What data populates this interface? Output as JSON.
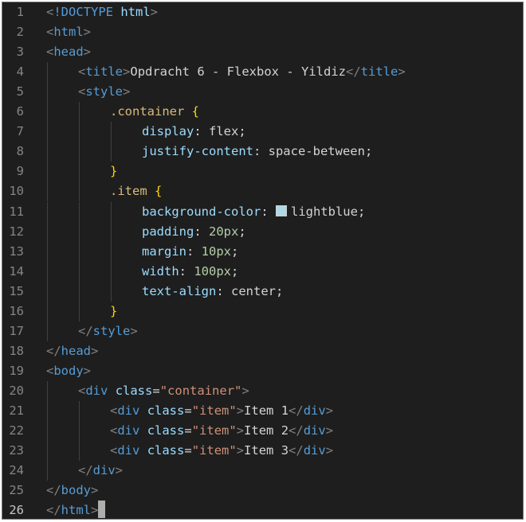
{
  "editor": {
    "active_line": 26,
    "colors": {
      "background": "#1e1e1e",
      "line_number": "#858585",
      "punctuation": "#808080",
      "tag": "#569cd6",
      "attribute": "#9cdcfe",
      "string": "#ce9178",
      "selector": "#d7ba7d",
      "number": "#b5cea8",
      "bracket": "#ffd700",
      "text": "#d4d4d4"
    },
    "lines": [
      {
        "n": "1",
        "indent": 0,
        "tokens": [
          [
            "punc",
            "<"
          ],
          [
            "tag",
            "!DOCTYPE "
          ],
          [
            "attr",
            "html"
          ],
          [
            "punc",
            ">"
          ]
        ]
      },
      {
        "n": "2",
        "indent": 0,
        "tokens": [
          [
            "punc",
            "<"
          ],
          [
            "tag",
            "html"
          ],
          [
            "punc",
            ">"
          ]
        ]
      },
      {
        "n": "3",
        "indent": 0,
        "tokens": [
          [
            "punc",
            "<"
          ],
          [
            "tag",
            "head"
          ],
          [
            "punc",
            ">"
          ]
        ]
      },
      {
        "n": "4",
        "indent": 1,
        "tokens": [
          [
            "punc",
            "<"
          ],
          [
            "tag",
            "title"
          ],
          [
            "punc",
            ">"
          ],
          [
            "txt",
            "Opdracht 6 - Flexbox - Yildiz"
          ],
          [
            "punc",
            "</"
          ],
          [
            "tag",
            "title"
          ],
          [
            "punc",
            ">"
          ]
        ]
      },
      {
        "n": "5",
        "indent": 1,
        "tokens": [
          [
            "punc",
            "<"
          ],
          [
            "tag",
            "style"
          ],
          [
            "punc",
            ">"
          ]
        ]
      },
      {
        "n": "6",
        "indent": 2,
        "tokens": [
          [
            "sel",
            ".container"
          ],
          [
            "txt",
            " "
          ],
          [
            "br",
            "{"
          ]
        ]
      },
      {
        "n": "7",
        "indent": 3,
        "tokens": [
          [
            "prop",
            "display"
          ],
          [
            "txt",
            ": flex;"
          ]
        ]
      },
      {
        "n": "8",
        "indent": 3,
        "tokens": [
          [
            "prop",
            "justify-content"
          ],
          [
            "txt",
            ": space-between;"
          ]
        ]
      },
      {
        "n": "9",
        "indent": 2,
        "tokens": [
          [
            "br",
            "}"
          ]
        ]
      },
      {
        "n": "10",
        "indent": 2,
        "tokens": [
          [
            "sel",
            ".item"
          ],
          [
            "txt",
            " "
          ],
          [
            "br",
            "{"
          ]
        ]
      },
      {
        "n": "11",
        "indent": 3,
        "tokens": [
          [
            "prop",
            "background-color"
          ],
          [
            "txt",
            ": "
          ],
          [
            "swatch",
            "#add8e6"
          ],
          [
            "txt",
            "lightblue;"
          ]
        ]
      },
      {
        "n": "12",
        "indent": 3,
        "tokens": [
          [
            "prop",
            "padding"
          ],
          [
            "txt",
            ": "
          ],
          [
            "num",
            "20px"
          ],
          [
            "txt",
            ";"
          ]
        ]
      },
      {
        "n": "13",
        "indent": 3,
        "tokens": [
          [
            "prop",
            "margin"
          ],
          [
            "txt",
            ": "
          ],
          [
            "num",
            "10px"
          ],
          [
            "txt",
            ";"
          ]
        ]
      },
      {
        "n": "14",
        "indent": 3,
        "tokens": [
          [
            "prop",
            "width"
          ],
          [
            "txt",
            ": "
          ],
          [
            "num",
            "100px"
          ],
          [
            "txt",
            ";"
          ]
        ]
      },
      {
        "n": "15",
        "indent": 3,
        "tokens": [
          [
            "prop",
            "text-align"
          ],
          [
            "txt",
            ": center;"
          ]
        ]
      },
      {
        "n": "16",
        "indent": 2,
        "tokens": [
          [
            "br",
            "}"
          ]
        ]
      },
      {
        "n": "17",
        "indent": 1,
        "tokens": [
          [
            "punc",
            "</"
          ],
          [
            "tag",
            "style"
          ],
          [
            "punc",
            ">"
          ]
        ]
      },
      {
        "n": "18",
        "indent": 0,
        "tokens": [
          [
            "punc",
            "</"
          ],
          [
            "tag",
            "head"
          ],
          [
            "punc",
            ">"
          ]
        ]
      },
      {
        "n": "19",
        "indent": 0,
        "tokens": [
          [
            "punc",
            "<"
          ],
          [
            "tag",
            "body"
          ],
          [
            "punc",
            ">"
          ]
        ]
      },
      {
        "n": "20",
        "indent": 1,
        "tokens": [
          [
            "punc",
            "<"
          ],
          [
            "tag",
            "div"
          ],
          [
            "txt",
            " "
          ],
          [
            "attr",
            "class"
          ],
          [
            "txt",
            "="
          ],
          [
            "str",
            "\"container\""
          ],
          [
            "punc",
            ">"
          ]
        ]
      },
      {
        "n": "21",
        "indent": 2,
        "tokens": [
          [
            "punc",
            "<"
          ],
          [
            "tag",
            "div"
          ],
          [
            "txt",
            " "
          ],
          [
            "attr",
            "class"
          ],
          [
            "txt",
            "="
          ],
          [
            "str",
            "\"item\""
          ],
          [
            "punc",
            ">"
          ],
          [
            "txt",
            "Item 1"
          ],
          [
            "punc",
            "</"
          ],
          [
            "tag",
            "div"
          ],
          [
            "punc",
            ">"
          ]
        ]
      },
      {
        "n": "22",
        "indent": 2,
        "tokens": [
          [
            "punc",
            "<"
          ],
          [
            "tag",
            "div"
          ],
          [
            "txt",
            " "
          ],
          [
            "attr",
            "class"
          ],
          [
            "txt",
            "="
          ],
          [
            "str",
            "\"item\""
          ],
          [
            "punc",
            ">"
          ],
          [
            "txt",
            "Item 2"
          ],
          [
            "punc",
            "</"
          ],
          [
            "tag",
            "div"
          ],
          [
            "punc",
            ">"
          ]
        ]
      },
      {
        "n": "23",
        "indent": 2,
        "tokens": [
          [
            "punc",
            "<"
          ],
          [
            "tag",
            "div"
          ],
          [
            "txt",
            " "
          ],
          [
            "attr",
            "class"
          ],
          [
            "txt",
            "="
          ],
          [
            "str",
            "\"item\""
          ],
          [
            "punc",
            ">"
          ],
          [
            "txt",
            "Item 3"
          ],
          [
            "punc",
            "</"
          ],
          [
            "tag",
            "div"
          ],
          [
            "punc",
            ">"
          ]
        ]
      },
      {
        "n": "24",
        "indent": 1,
        "tokens": [
          [
            "punc",
            "</"
          ],
          [
            "tag",
            "div"
          ],
          [
            "punc",
            ">"
          ]
        ]
      },
      {
        "n": "25",
        "indent": 0,
        "tokens": [
          [
            "punc",
            "</"
          ],
          [
            "tag",
            "body"
          ],
          [
            "punc",
            ">"
          ]
        ]
      },
      {
        "n": "26",
        "indent": 0,
        "tokens": [
          [
            "punc",
            "</"
          ],
          [
            "tag",
            "html"
          ],
          [
            "punc",
            ">"
          ]
        ],
        "cursor": true
      }
    ]
  }
}
